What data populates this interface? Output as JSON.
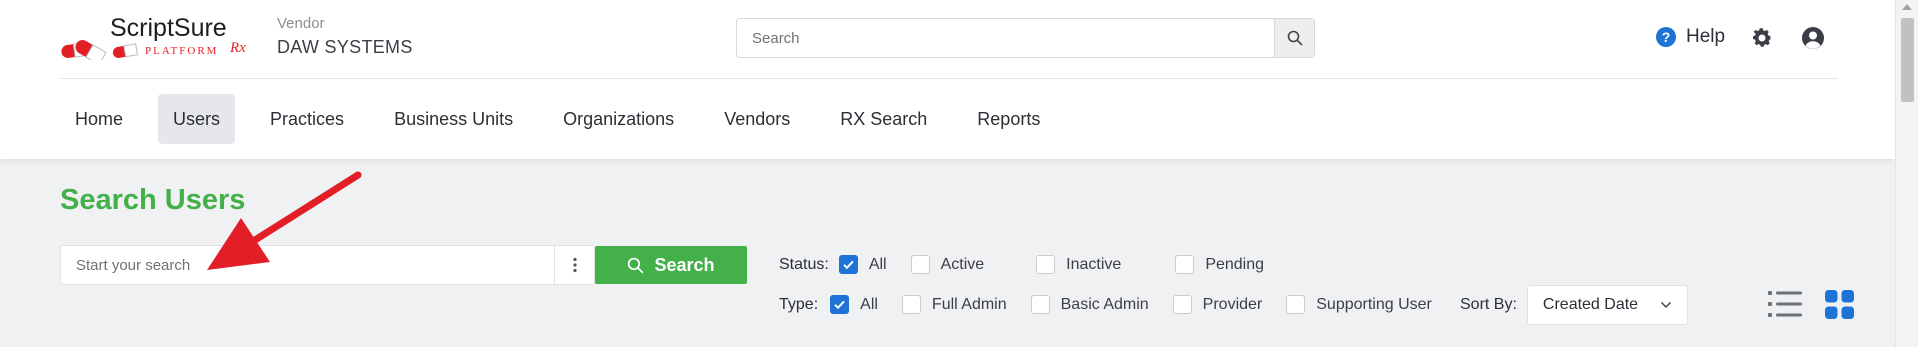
{
  "brand": {
    "logo_text": "ScriptSure",
    "logo_rx": "Rx",
    "logo_sub": "PLATFORM",
    "accent": "#43b04a",
    "logo_red": "#e21f26"
  },
  "vendor": {
    "label": "Vendor",
    "name": "DAW SYSTEMS"
  },
  "top_search": {
    "placeholder": "Search"
  },
  "header_actions": {
    "help_label": "Help"
  },
  "nav": {
    "items": [
      {
        "label": "Home",
        "active": false
      },
      {
        "label": "Users",
        "active": true
      },
      {
        "label": "Practices",
        "active": false
      },
      {
        "label": "Business Units",
        "active": false
      },
      {
        "label": "Organizations",
        "active": false
      },
      {
        "label": "Vendors",
        "active": false
      },
      {
        "label": "RX Search",
        "active": false
      },
      {
        "label": "Reports",
        "active": false
      }
    ]
  },
  "page": {
    "title": "Search Users"
  },
  "user_search": {
    "placeholder": "Start your search",
    "button_label": "Search"
  },
  "filters": {
    "status": {
      "label": "Status:",
      "options": [
        {
          "label": "All",
          "checked": true
        },
        {
          "label": "Active",
          "checked": false
        },
        {
          "label": "Inactive",
          "checked": false
        },
        {
          "label": "Pending",
          "checked": false
        }
      ]
    },
    "type": {
      "label": "Type:",
      "options": [
        {
          "label": "All",
          "checked": true
        },
        {
          "label": "Full Admin",
          "checked": false
        },
        {
          "label": "Basic Admin",
          "checked": false
        },
        {
          "label": "Provider",
          "checked": false
        },
        {
          "label": "Supporting User",
          "checked": false
        }
      ]
    }
  },
  "sort": {
    "label": "Sort By:",
    "selected": "Created Date"
  },
  "colors": {
    "checkbox_blue": "#1e74d6",
    "view_active_blue": "#1e74d6",
    "annotation_red": "#e21f26"
  }
}
